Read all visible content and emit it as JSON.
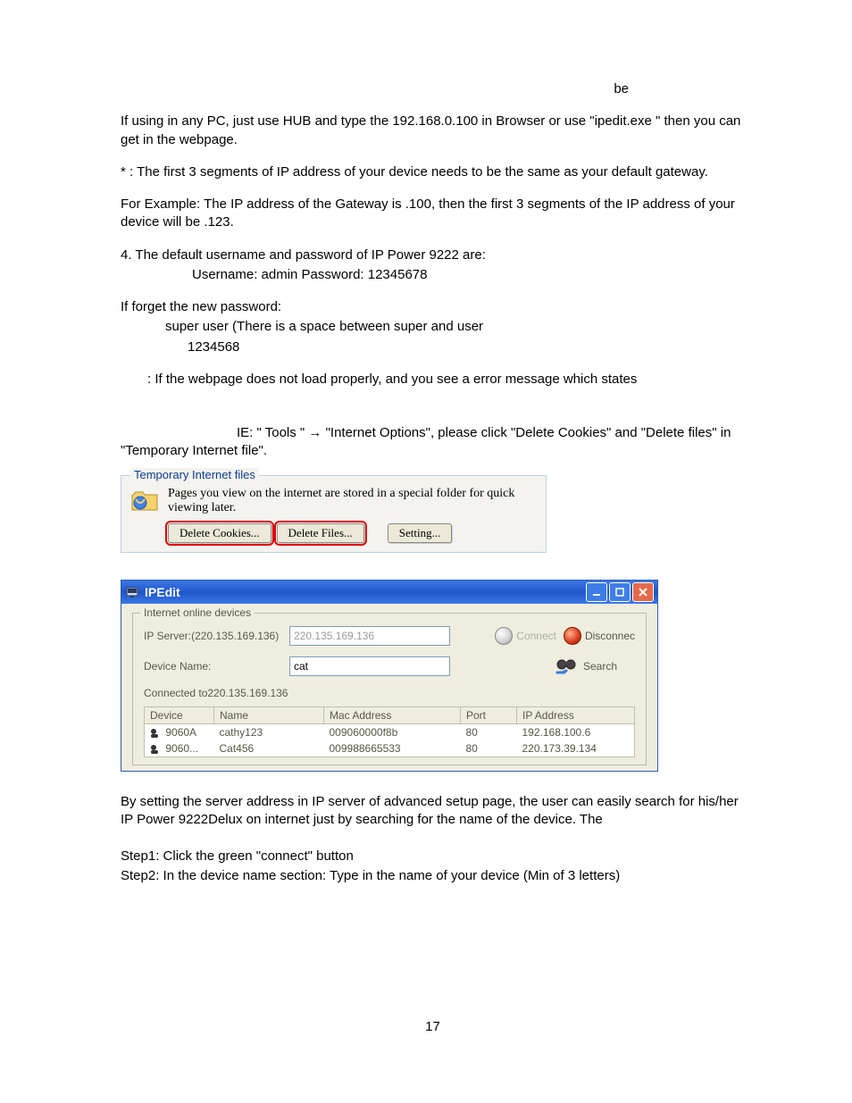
{
  "text": {
    "be_tail": "be",
    "p1": "If using in any PC, just use HUB and type the 192.168.0.100 in Browser or use \"ipedit.exe \" then you can get in the webpage.",
    "p2": "*        : The first 3 segments of IP address of your device needs to be the same as your default gateway.",
    "p3": "For Example: The IP address of the Gateway is             .100,    then the first 3 segments of the IP address of your device will be                  .123.",
    "p4": "4. The default username and password of IP Power 9222 are:",
    "p4a": "Username: admin               Password:  12345678",
    "p5": "If forget the new password:",
    "p5a": "super user (There is a space between super and user",
    "p5b": "1234568",
    "p6": ": If  the webpage does not load properly, and you see a error message which states",
    "p7": "IE:  \" Tools \" → \"Internet Options\", please click   \"Delete  Cookies\" and \"Delete files\" in   \"Temporary Internet file\".",
    "p8": "By setting the server address in IP server of advanced setup page, the user can easily search for his/her IP Power 9222Delux on internet just by searching for the name of the device. The",
    "p9": "Step1: Click the green \"connect\" button",
    "p10": "Step2: In the device name section: Type in the name of your device (Min of 3 letters)",
    "page_num": "17"
  },
  "tif": {
    "legend": "Temporary Internet files",
    "desc": "Pages you view on the internet are stored in a special folder for quick viewing later.",
    "delete_cookies": "Delete Cookies...",
    "delete_files": "Delete Files...",
    "setting": "Setting..."
  },
  "ipedit": {
    "title": "IPEdit",
    "fs_legend": "Internet online devices",
    "ip_server_label": "IP Server:(220.135.169.136)",
    "ip_server_value": "220.135.169.136",
    "connect": "Connect",
    "disconnect": "Disconnec",
    "device_name_label": "Device Name:",
    "device_name_value": "cat",
    "search": "Search",
    "status": "Connected to220.135.169.136",
    "headers": {
      "device": "Device",
      "name": "Name",
      "mac": "Mac Address",
      "port": "Port",
      "ip": "IP Address"
    },
    "rows": [
      {
        "device": "9060A",
        "name": "cathy123",
        "mac": "009060000f8b",
        "port": "80",
        "ip": "192.168.100.6"
      },
      {
        "device": "9060...",
        "name": "Cat456",
        "mac": "009988665533",
        "port": "80",
        "ip": "220.173.39.134"
      }
    ]
  }
}
